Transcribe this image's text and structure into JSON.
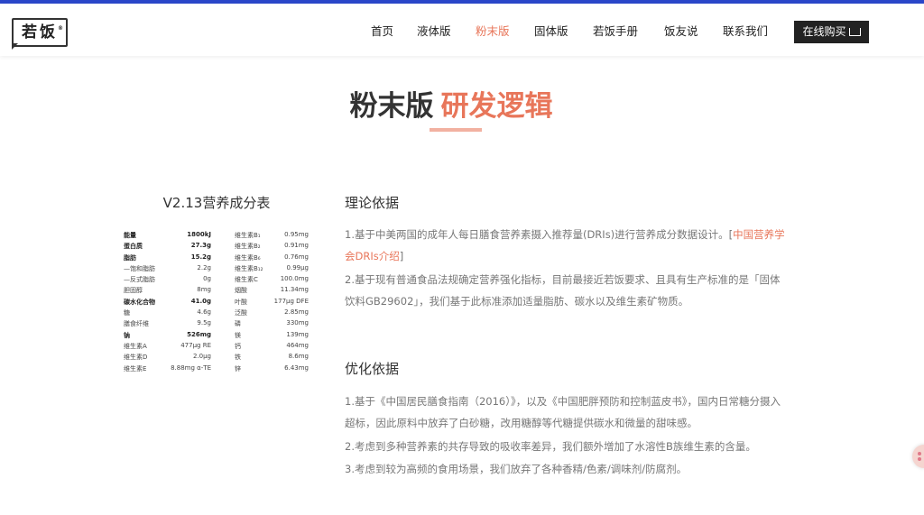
{
  "header": {
    "logo_text": "若饭",
    "logo_mark": "®",
    "nav": [
      "首页",
      "液体版",
      "粉末版",
      "固体版",
      "若饭手册",
      "饭友说",
      "联系我们"
    ],
    "active_nav": "粉末版",
    "buy_label": "在线购买"
  },
  "colors": {
    "accent": "#e8765a",
    "topbar": "#2a46c9",
    "title_underline": "#f2b1a1"
  },
  "title": {
    "part1": "粉末版",
    "part2": "研发逻辑"
  },
  "table": {
    "title": "V2.13营养成分表",
    "rows": [
      {
        "n1": "能量",
        "v1": "1800kJ",
        "n2": "维生素B₁",
        "v2": "0.95mg",
        "bold": true
      },
      {
        "n1": "蛋白质",
        "v1": "27.3g",
        "n2": "维生素B₂",
        "v2": "0.91mg",
        "bold": true
      },
      {
        "n1": "脂肪",
        "v1": "15.2g",
        "n2": "维生素B₆",
        "v2": "0.76mg",
        "bold": true
      },
      {
        "n1": "—饱和脂肪",
        "v1": "2.2g",
        "n2": "维生素B₁₂",
        "v2": "0.99μg",
        "bold": false
      },
      {
        "n1": "—反式脂肪",
        "v1": "0g",
        "n2": "维生素C",
        "v2": "100.0mg",
        "bold": false
      },
      {
        "n1": "胆固醇",
        "v1": "8mg",
        "n2": "烟酸",
        "v2": "11.34mg",
        "bold": false
      },
      {
        "n1": "碳水化合物",
        "v1": "41.0g",
        "n2": "叶酸",
        "v2": "177μg DFE",
        "bold": true
      },
      {
        "n1": "糖",
        "v1": "4.6g",
        "n2": "泛酸",
        "v2": "2.85mg",
        "bold": false
      },
      {
        "n1": "膳食纤维",
        "v1": "9.5g",
        "n2": "磷",
        "v2": "330mg",
        "bold": false
      },
      {
        "n1": "钠",
        "v1": "526mg",
        "n2": "镁",
        "v2": "139mg",
        "bold": true
      },
      {
        "n1": "维生素A",
        "v1": "477μg RE",
        "n2": "钙",
        "v2": "464mg",
        "bold": false
      },
      {
        "n1": "维生素D",
        "v1": "2.0μg",
        "n2": "铁",
        "v2": "8.6mg",
        "bold": false
      },
      {
        "n1": "维生素E",
        "v1": "8.88mg α-TE",
        "n2": "锌",
        "v2": "6.43mg",
        "bold": false
      }
    ]
  },
  "theory": {
    "heading": "理论依据",
    "p1_text": "1.基于中美两国的成年人每日膳食营养素摄入推荐量(DRIs)进行营养成分数据设计。[",
    "p1_link": "中国营养学会DRIs介绍",
    "p1_end": "]",
    "p2": "2.基于现有普通食品法规确定营养强化指标，目前最接近若饭要求、且具有生产标准的是「固体饮料GB29602」，我们基于此标准添加适量脂肪、碳水以及维生素矿物质。"
  },
  "optimize": {
    "heading": "优化依据",
    "p1": "1.基于《中国居民膳食指南（2016）》，以及《中国肥胖预防和控制蓝皮书》，国内日常糖分摄入超标，因此原料中放弃了白砂糖，改用糖醇等代糖提供碳水和微量的甜味感。",
    "p2": "2.考虑到多种营养素的共存导致的吸收率差异，我们额外增加了水溶性B族维生素的含量。",
    "p3": "3.考虑到较为高频的食用场景，我们放弃了各种香精/色素/调味剂/防腐剂。"
  }
}
